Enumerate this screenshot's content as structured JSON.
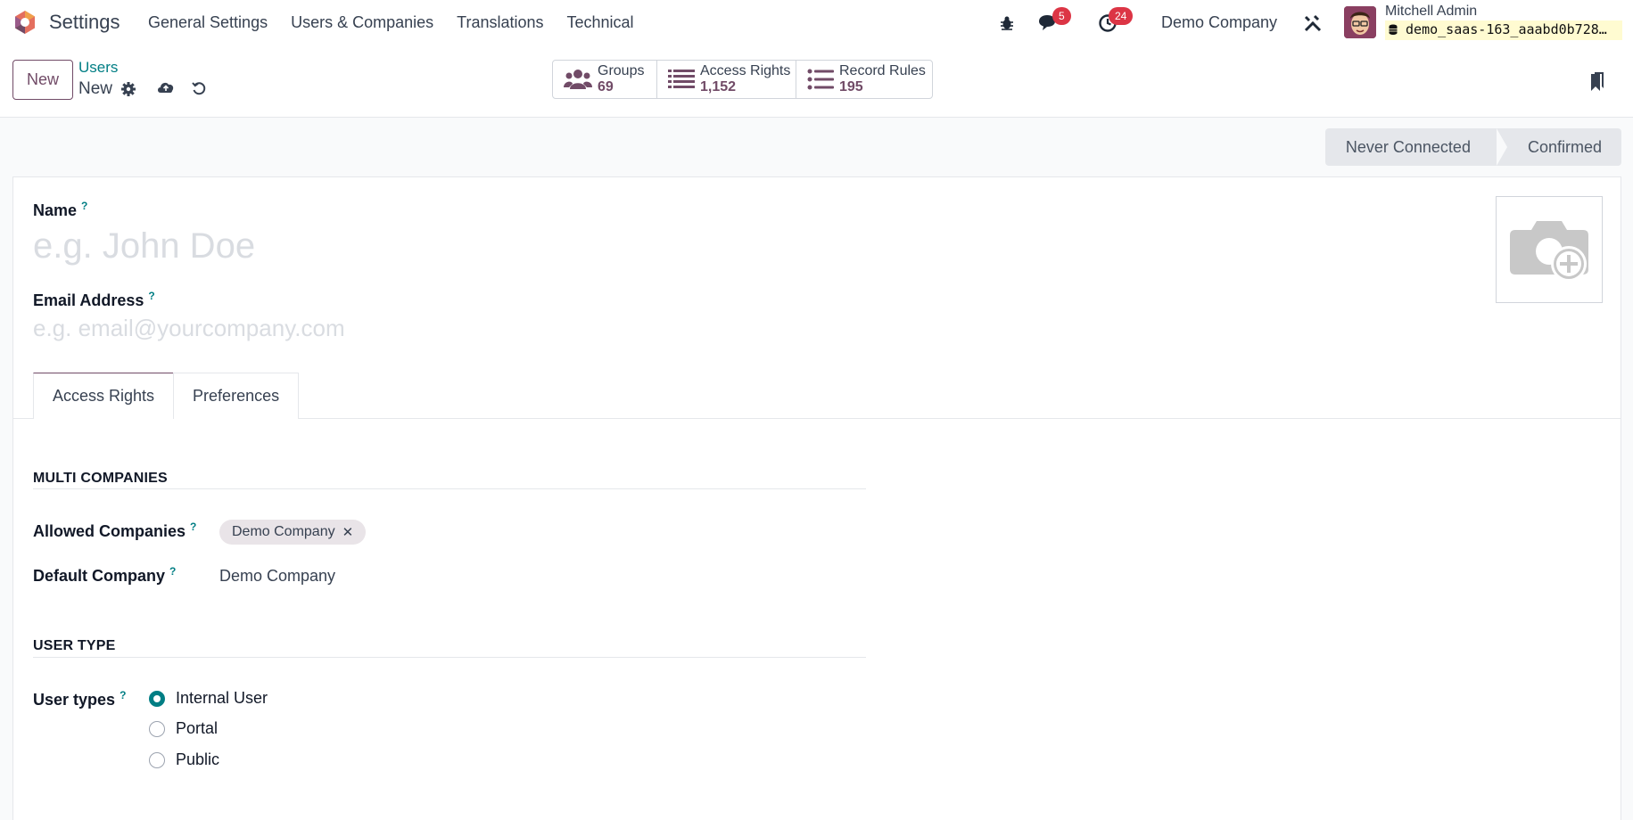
{
  "navbar": {
    "app_name": "Settings",
    "menu": [
      "General Settings",
      "Users & Companies",
      "Translations",
      "Technical"
    ],
    "messages_count": "5",
    "activities_count": "24",
    "company": "Demo Company",
    "user_name": "Mitchell Admin",
    "db_name": "demo_saas-163_aaabd0b728…"
  },
  "control": {
    "new_label": "New",
    "breadcrumb_parent": "Users",
    "breadcrumb_current": "New",
    "stats": [
      {
        "label": "Groups",
        "value": "69",
        "icon": "users-icon"
      },
      {
        "label": "Access Rights",
        "value": "1,152",
        "icon": "list-icon"
      },
      {
        "label": "Record Rules",
        "value": "195",
        "icon": "list-icon"
      }
    ]
  },
  "status": {
    "stages": [
      "Never Connected",
      "Confirmed"
    ]
  },
  "form": {
    "name_label": "Name",
    "name_placeholder": "e.g. John Doe",
    "email_label": "Email Address",
    "email_placeholder": "e.g. email@yourcompany.com",
    "help_mark": "?",
    "tabs": [
      "Access Rights",
      "Preferences"
    ],
    "multi_companies_title": "MULTI COMPANIES",
    "allowed_companies_label": "Allowed Companies",
    "allowed_companies": [
      "Demo Company"
    ],
    "default_company_label": "Default Company",
    "default_company_value": "Demo Company",
    "user_type_title": "USER TYPE",
    "user_types_label": "User types",
    "user_types": [
      "Internal User",
      "Portal",
      "Public"
    ],
    "user_type_selected": "Internal User"
  },
  "colors": {
    "brand": "#714b67",
    "accent": "#017e84",
    "badge": "#dc3545"
  }
}
